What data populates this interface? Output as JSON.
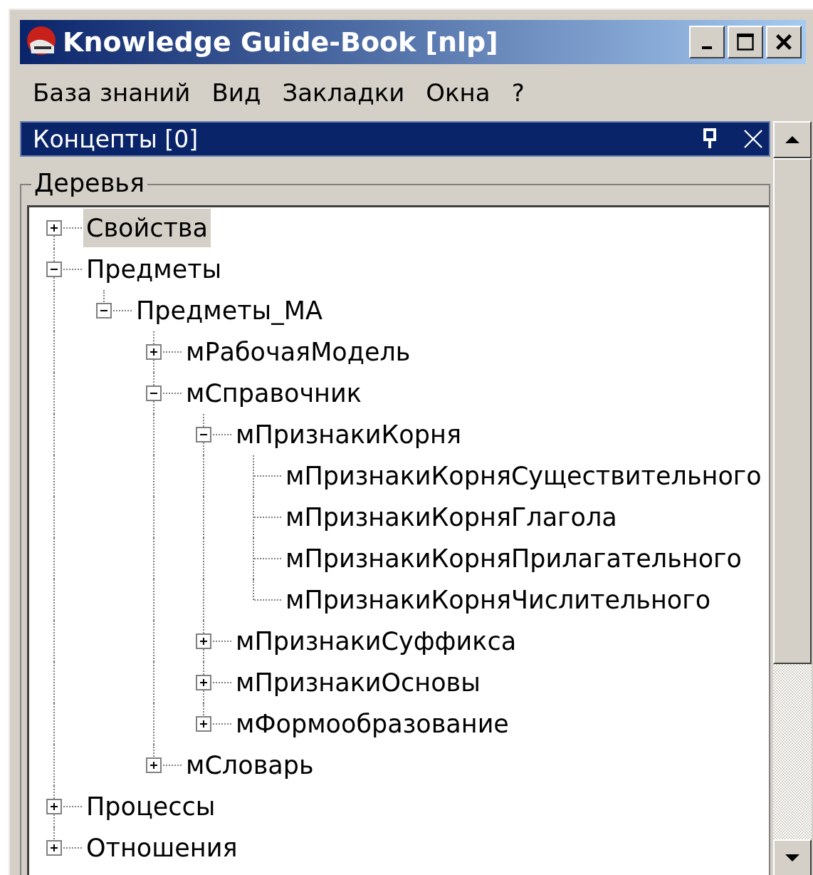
{
  "window": {
    "title": "Knowledge Guide-Book [nlp]"
  },
  "menu": [
    "База знаний",
    "Вид",
    "Закладки",
    "Окна",
    "?"
  ],
  "panel": {
    "title": "Концепты [0]",
    "group_label": "Деревья",
    "tree": [
      {
        "label": "Свойства",
        "selected": true,
        "expanded": false
      },
      {
        "label": "Предметы",
        "selected": false,
        "expanded": true,
        "children": [
          {
            "label": "Предметы_МА",
            "selected": false,
            "expanded": true,
            "children": [
              {
                "label": "мРабочаяМодель",
                "selected": false,
                "expanded": false
              },
              {
                "label": "мСправочник",
                "selected": false,
                "expanded": true,
                "children": [
                  {
                    "label": "мПризнакиКорня",
                    "selected": false,
                    "expanded": true,
                    "children": [
                      {
                        "label": "мПризнакиКорняСуществительного",
                        "selected": false
                      },
                      {
                        "label": "мПризнакиКорняГлагола",
                        "selected": false
                      },
                      {
                        "label": "мПризнакиКорняПрилагательного",
                        "selected": false
                      },
                      {
                        "label": "мПризнакиКорняЧислительного",
                        "selected": false
                      }
                    ]
                  },
                  {
                    "label": "мПризнакиСуффикса",
                    "selected": false,
                    "expanded": false
                  },
                  {
                    "label": "мПризнакиОсновы",
                    "selected": false,
                    "expanded": false
                  },
                  {
                    "label": "мФормообразование",
                    "selected": false,
                    "expanded": false
                  }
                ]
              },
              {
                "label": "мСловарь",
                "selected": false,
                "expanded": false
              }
            ]
          }
        ]
      },
      {
        "label": "Процессы",
        "selected": false,
        "expanded": false
      },
      {
        "label": "Отношения",
        "selected": false,
        "expanded": false
      }
    ]
  }
}
